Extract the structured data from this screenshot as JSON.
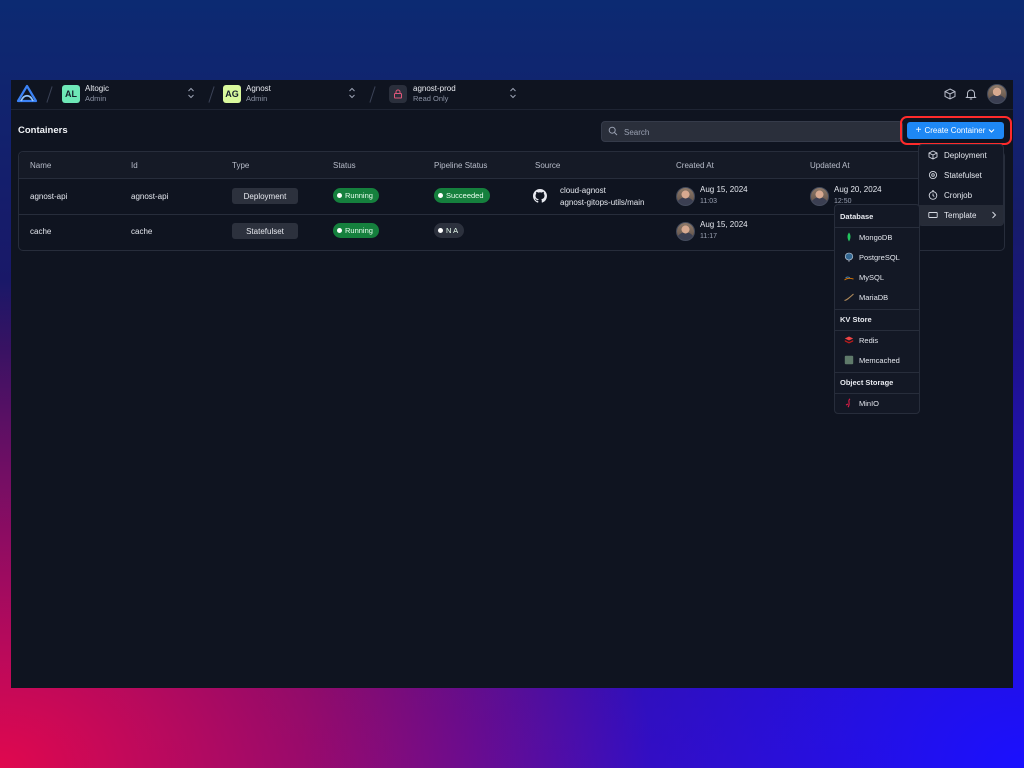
{
  "topbar": {
    "org": {
      "badge": "AL",
      "name": "Altogic",
      "role": "Admin",
      "badge_color": "#6ee7b7"
    },
    "app": {
      "badge": "AG",
      "name": "Agnost",
      "role": "Admin",
      "badge_color": "#d9f99d"
    },
    "env": {
      "name": "agnost-prod",
      "status": "Read Only",
      "lock_color": "#e0577a"
    },
    "icons": [
      "cube-icon",
      "bell-icon",
      "user-avatar"
    ]
  },
  "page": {
    "title": "Containers"
  },
  "search": {
    "placeholder": "Search"
  },
  "create_button": {
    "label": "Create Container",
    "color": "#1e88f5",
    "highlight_color": "#ff2b2b"
  },
  "table": {
    "headers": [
      "Name",
      "Id",
      "Type",
      "Status",
      "Pipeline Status",
      "Source",
      "Created At",
      "Updated At"
    ],
    "rows": [
      {
        "name": "agnost-api",
        "id": "agnost-api",
        "type": "Deployment",
        "status": "Running",
        "pipeline": "Succeeded",
        "source_repo": "cloud-agnost",
        "source_branch": "agnost-gitops-utils/main",
        "created_date": "Aug 15, 2024",
        "created_time": "11:03",
        "updated_date": "Aug 20, 2024",
        "updated_time": "12:50"
      },
      {
        "name": "cache",
        "id": "cache",
        "type": "Statefulset",
        "status": "Running",
        "pipeline": "N A",
        "created_date": "Aug 15, 2024",
        "created_time": "11:17"
      }
    ]
  },
  "create_menu": {
    "items": [
      {
        "label": "Deployment",
        "icon": "cube-icon"
      },
      {
        "label": "Statefulset",
        "icon": "gear-icon"
      },
      {
        "label": "Cronjob",
        "icon": "clock-icon"
      },
      {
        "label": "Template",
        "icon": "template-icon"
      }
    ]
  },
  "template_menu": {
    "groups": [
      {
        "heading": "Database",
        "items": [
          "MongoDB",
          "PostgreSQL",
          "MySQL",
          "MariaDB"
        ]
      },
      {
        "heading": "KV Store",
        "items": [
          "Redis",
          "Memcached"
        ]
      },
      {
        "heading": "Object Storage",
        "items": [
          "MinIO"
        ]
      }
    ]
  },
  "colors": {
    "running": "#15803d",
    "succeeded": "#15803d",
    "na": "#2c313d",
    "background": "#0f1420"
  }
}
